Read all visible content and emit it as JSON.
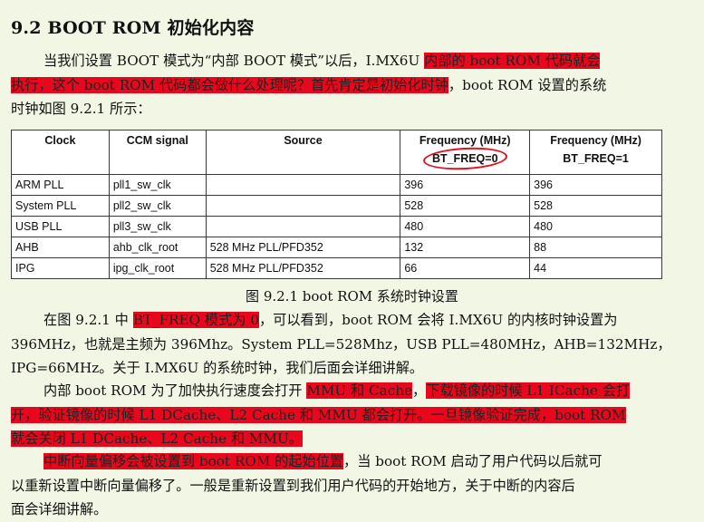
{
  "heading": "9.2 BOOT ROM 初始化内容",
  "para1": {
    "l1_a": "当我们设置 BOOT 模式为“内部 BOOT 模式”以后，I.MX6U ",
    "l1_b": "内部的 boot ROM 代码就会",
    "l2_a": "执行，这个 boot ROM 代码都会做什么处理呢？首先肯定是初始化时钟",
    "l2_b": "，boot ROM 设置的系统",
    "l3": "时钟如图 9.2.1 所示："
  },
  "table": {
    "headers": [
      "Clock",
      "CCM signal",
      "Source",
      "Frequency (MHz)",
      "Frequency (MHz)"
    ],
    "subheaders": [
      "",
      "",
      "",
      "BT_FREQ=0",
      "BT_FREQ=1"
    ],
    "rows": [
      [
        "ARM PLL",
        "pll1_sw_clk",
        "",
        "396",
        "396"
      ],
      [
        "System PLL",
        "pll2_sw_clk",
        "",
        "528",
        "528"
      ],
      [
        "USB PLL",
        "pll3_sw_clk",
        "",
        "480",
        "480"
      ],
      [
        "AHB",
        "ahb_clk_root",
        "528 MHz PLL/PFD352",
        "132",
        "88"
      ],
      [
        "IPG",
        "ipg_clk_root",
        "528 MHz PLL/PFD352",
        "66",
        "44"
      ]
    ]
  },
  "caption": "图 9.2.1 boot ROM 系统时钟设置",
  "para2": {
    "l1_a": "在图 9.2.1 中 ",
    "l1_b": "BT_FREQ 模式为 0",
    "l1_c": "，可以看到，boot ROM 会将 I.MX6U 的内核时钟设置为",
    "l2": "396MHz，也就是主频为 396Mhz。System PLL=528Mhz，USB PLL=480MHz，AHB=132MHz，",
    "l3": "IPG=66MHz。关于 I.MX6U 的系统时钟，我们后面会详细讲解。"
  },
  "para3": {
    "l1_a": "内部 boot ROM 为了加快执行速度会打开 ",
    "l1_b": "MMU 和 Cache",
    "l1_c": "，",
    "l1_d": "下载镜像的时候 L1 ICache 会打",
    "l2": "开，验证镜像的时候 L1 DCache、L2 Cache 和 MMU 都会打开。一旦镜像验证完成，boot ROM",
    "l3": "就会关闭 L1 DCache、L2 Cache 和 MMU。"
  },
  "para4": {
    "l1_a": "中断向量偏移会被设置到 boot ROM 的起始位置",
    "l1_b": "，当 boot ROM 启动了用户代码以后就可",
    "l2": "以重新设置中断向量偏移了。一般是重新设置到我们用户代码的开始地方，关于中断的内容后",
    "l3": "面会详细讲解。"
  },
  "colors": {
    "background": "#f1f6e5",
    "highlight": "#e8071c",
    "circle": "#e50f1f"
  }
}
